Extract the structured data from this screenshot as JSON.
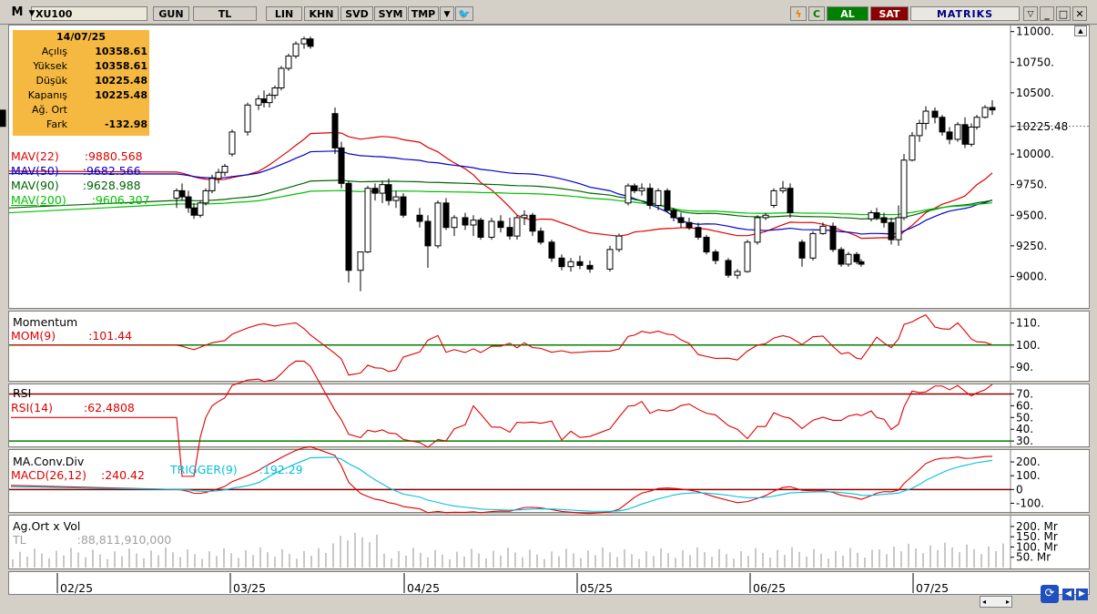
{
  "toolbar": {
    "logo": "M",
    "symbol": "XU100",
    "buttons": [
      "GUN",
      "TL",
      "LIN",
      "KHN",
      "SVD",
      "SYM",
      "TMP"
    ],
    "al": "AL",
    "sat": "SAT",
    "brand": "MATRIKS"
  },
  "info": {
    "date": "14/07/25",
    "rows": [
      {
        "k": "Açılış",
        "v": "10358.61"
      },
      {
        "k": "Yüksek",
        "v": "10358.61"
      },
      {
        "k": "Düşük",
        "v": "10225.48"
      },
      {
        "k": "Kapanış",
        "v": "10225.48"
      },
      {
        "k": "Ağ. Ort",
        "v": ""
      },
      {
        "k": "Fark",
        "v": "-132.98"
      }
    ]
  },
  "legend": {
    "mav22": "MAV(22)",
    "mav22_val": ":9880.568",
    "mav50": "MAV(50)",
    "mav50_val": ":9682.566",
    "mav90": "MAV(90)",
    "mav90_val": ":9628.988",
    "mav200": "MAV(200)",
    "mav200_val": ":9606.307",
    "mom_title": "Momentum",
    "mom": "MOM(9)",
    "mom_val": ":101.44",
    "rsi_title": "RSI",
    "rsi": "RSI(14)",
    "rsi_val": ":62.4808",
    "macd_title": "MA.Conv.Div",
    "macd": "MACD(26,12)",
    "macd_val": ":240.42",
    "trigger": "TRIGGER(9)",
    "trigger_val": ":192.29",
    "vol_title": "Ag.Ort x Vol",
    "vol": "TL",
    "vol_val": ":88,811,910,000"
  },
  "colors": {
    "mav22": "#e00000",
    "mav50": "#0000cc",
    "mav90": "#006400",
    "mav200": "#00c000",
    "mom": "#e00000",
    "rsi": "#e00000",
    "macd": "#e00000",
    "trigger": "#00c0e0",
    "ref_green": "#008000",
    "ref_red": "#8b0000"
  },
  "chart_data": [
    {
      "type": "candlestick",
      "title": "XU100",
      "x_ticks": [
        "02/25",
        "03/25",
        "04/25",
        "05/25",
        "06/25",
        "07/25"
      ],
      "y_ticks": [
        11000,
        10750,
        10500,
        10225.48,
        10000,
        9750,
        9500,
        9250,
        9000
      ],
      "y_tick_labels": [
        "11000.",
        "10750.",
        "10500.",
        "10225.48",
        "10000.",
        "9750.",
        "9500.",
        "9250.",
        "9000."
      ],
      "last_close": 10225.48,
      "ylim": [
        8780,
        11020
      ],
      "candles": [
        [
          9640,
          9720,
          9560,
          9700
        ],
        [
          9700,
          9760,
          9620,
          9650
        ],
        [
          9650,
          9700,
          9520,
          9560
        ],
        [
          9560,
          9600,
          9470,
          9500
        ],
        [
          9500,
          9620,
          9480,
          9600
        ],
        [
          9600,
          9720,
          9580,
          9700
        ],
        [
          9700,
          9830,
          9680,
          9800
        ],
        [
          9800,
          9880,
          9760,
          9850
        ],
        [
          9850,
          9920,
          9820,
          9900
        ],
        [
          10000,
          10200,
          9980,
          10180
        ],
        [
          10180,
          10420,
          10150,
          10400
        ],
        [
          10400,
          10480,
          10360,
          10450
        ],
        [
          10450,
          10520,
          10380,
          10420
        ],
        [
          10420,
          10500,
          10380,
          10480
        ],
        [
          10480,
          10560,
          10450,
          10540
        ],
        [
          10540,
          10720,
          10520,
          10700
        ],
        [
          10700,
          10820,
          10680,
          10800
        ],
        [
          10800,
          10920,
          10780,
          10900
        ],
        [
          10900,
          10960,
          10860,
          10940
        ],
        [
          10940,
          10960,
          10860,
          10880
        ],
        [
          10330,
          10380,
          10000,
          10050
        ],
        [
          10050,
          10100,
          9720,
          9760
        ],
        [
          9760,
          9780,
          8950,
          9050
        ],
        [
          9050,
          9100,
          8880,
          9200
        ],
        [
          9200,
          9740,
          9190,
          9720
        ],
        [
          9720,
          9760,
          9620,
          9680
        ],
        [
          9680,
          9780,
          9600,
          9750
        ],
        [
          9750,
          9800,
          9580,
          9620
        ],
        [
          9620,
          9700,
          9560,
          9650
        ],
        [
          9650,
          9680,
          9480,
          9500
        ],
        [
          9500,
          9560,
          9400,
          9450
        ],
        [
          9450,
          9500,
          9070,
          9250
        ],
        [
          9250,
          9620,
          9230,
          9600
        ],
        [
          9600,
          9640,
          9380,
          9400
        ],
        [
          9400,
          9500,
          9330,
          9480
        ],
        [
          9480,
          9520,
          9380,
          9420
        ],
        [
          9420,
          9500,
          9330,
          9460
        ],
        [
          9460,
          9480,
          9300,
          9320
        ],
        [
          9320,
          9480,
          9300,
          9450
        ],
        [
          9450,
          9500,
          9360,
          9400
        ],
        [
          9400,
          9480,
          9300,
          9330
        ],
        [
          9330,
          9500,
          9300,
          9480
        ],
        [
          9480,
          9540,
          9420,
          9500
        ],
        [
          9500,
          9520,
          9330,
          9370
        ],
        [
          9370,
          9400,
          9260,
          9280
        ],
        [
          9280,
          9300,
          9120,
          9150
        ],
        [
          9150,
          9180,
          9050,
          9080
        ],
        [
          9080,
          9150,
          9040,
          9120
        ],
        [
          9120,
          9170,
          9060,
          9090
        ],
        [
          9090,
          9130,
          9030,
          9060
        ],
        [
          9060,
          9250,
          9040,
          9220
        ],
        [
          9220,
          9350,
          9200,
          9330
        ],
        [
          9600,
          9760,
          9580,
          9740
        ],
        [
          9740,
          9760,
          9680,
          9700
        ],
        [
          9700,
          9760,
          9660,
          9720
        ],
        [
          9720,
          9760,
          9550,
          9580
        ],
        [
          9580,
          9720,
          9540,
          9700
        ],
        [
          9700,
          9720,
          9520,
          9540
        ],
        [
          9540,
          9560,
          9450,
          9480
        ],
        [
          9480,
          9520,
          9400,
          9440
        ],
        [
          9440,
          9480,
          9380,
          9400
        ],
        [
          9400,
          9440,
          9300,
          9320
        ],
        [
          9320,
          9340,
          9180,
          9200
        ],
        [
          9200,
          9220,
          9100,
          9130
        ],
        [
          9130,
          9150,
          8990,
          9010
        ],
        [
          9010,
          9060,
          8980,
          9040
        ],
        [
          9040,
          9300,
          9030,
          9280
        ],
        [
          9280,
          9500,
          9260,
          9480
        ],
        [
          9480,
          9520,
          9460,
          9500
        ],
        [
          9580,
          9720,
          9560,
          9700
        ],
        [
          9700,
          9780,
          9680,
          9720
        ],
        [
          9720,
          9760,
          9480,
          9520
        ],
        [
          9280,
          9300,
          9080,
          9150
        ],
        [
          9150,
          9370,
          9130,
          9350
        ],
        [
          9350,
          9440,
          9340,
          9410
        ],
        [
          9410,
          9440,
          9200,
          9220
        ],
        [
          9220,
          9240,
          9080,
          9100
        ],
        [
          9100,
          9200,
          9080,
          9180
        ],
        [
          9180,
          9200,
          9100,
          9120
        ],
        [
          9120,
          9140,
          9080,
          9100
        ],
        [
          9470,
          9540,
          9450,
          9520
        ],
        [
          9520,
          9560,
          9460,
          9480
        ],
        [
          9480,
          9520,
          9400,
          9440
        ],
        [
          9440,
          9480,
          9260,
          9300
        ],
        [
          9300,
          9580,
          9250,
          9480
        ],
        [
          9480,
          10000,
          9460,
          9950
        ],
        [
          9950,
          10180,
          9940,
          10150
        ],
        [
          10150,
          10280,
          10100,
          10250
        ],
        [
          10250,
          10390,
          10200,
          10350
        ],
        [
          10350,
          10380,
          10250,
          10300
        ],
        [
          10300,
          10320,
          10150,
          10180
        ],
        [
          10180,
          10220,
          10080,
          10120
        ],
        [
          10120,
          10260,
          10100,
          10240
        ],
        [
          10240,
          10300,
          10050,
          10080
        ],
        [
          10080,
          10250,
          10060,
          10220
        ],
        [
          10220,
          10320,
          10200,
          10300
        ],
        [
          10300,
          10400,
          10290,
          10380
        ],
        [
          10380,
          10440,
          10320,
          10360
        ],
        [
          10358.61,
          10358.61,
          10225.48,
          10225.48
        ]
      ],
      "candle_x": [
        194,
        200,
        207,
        213,
        220,
        226,
        233,
        240,
        247,
        255,
        272,
        284,
        290,
        296,
        302,
        309,
        317,
        325,
        334,
        341,
        368,
        375,
        383,
        396,
        404,
        412,
        420,
        427,
        435,
        443,
        461,
        470,
        481,
        490,
        499,
        511,
        520,
        528,
        540,
        550,
        560,
        568,
        576,
        585,
        594,
        606,
        617,
        627,
        637,
        648,
        670,
        680,
        690,
        697,
        705,
        714,
        723,
        733,
        740,
        748,
        757,
        767,
        776,
        786,
        800,
        810,
        821,
        832,
        841,
        850,
        860,
        868,
        881,
        893,
        904,
        915,
        924,
        932,
        941,
        946,
        957,
        963,
        971,
        979,
        987,
        993,
        1002,
        1010,
        1017,
        1027,
        1035,
        1043,
        1052,
        1060,
        1067,
        1073,
        1082,
        1090
      ],
      "series": [
        {
          "name": "MAV(22)",
          "last": 9880.568
        },
        {
          "name": "MAV(50)",
          "last": 9682.566
        },
        {
          "name": "MAV(90)",
          "last": 9628.988
        },
        {
          "name": "MAV(200)",
          "last": 9606.307
        }
      ]
    },
    {
      "type": "line",
      "title": "Momentum",
      "series": [
        {
          "name": "MOM(9)",
          "last": 101.44
        }
      ],
      "y_ticks": [
        110,
        100,
        90
      ],
      "y_tick_labels": [
        "110.",
        "100.",
        "90."
      ],
      "ylim": [
        85,
        114
      ],
      "reference": 100
    },
    {
      "type": "line",
      "title": "RSI",
      "series": [
        {
          "name": "RSI(14)",
          "last": 62.4808
        }
      ],
      "y_ticks": [
        70,
        60,
        50,
        40,
        30
      ],
      "y_tick_labels": [
        "70.",
        "60.",
        "50.",
        "40.",
        "30."
      ],
      "ylim": [
        27,
        75
      ],
      "reference": [
        70,
        30
      ]
    },
    {
      "type": "line",
      "title": "MA.Conv.Div",
      "series": [
        {
          "name": "MACD(26,12)",
          "last": 240.42
        },
        {
          "name": "TRIGGER(9)",
          "last": 192.29
        }
      ],
      "y_ticks": [
        200,
        100,
        0,
        -100
      ],
      "y_tick_labels": [
        "200.",
        "100.",
        "0",
        "-100."
      ],
      "ylim": [
        -150,
        260
      ],
      "reference": 0
    },
    {
      "type": "bar",
      "title": "Ag.Ort x Vol",
      "series": [
        {
          "name": "TL",
          "last": 88811910000
        }
      ],
      "y_ticks": [
        200,
        150,
        100,
        50
      ],
      "y_tick_labels": [
        "200. Mr",
        "150. Mr",
        "100. Mr",
        "50. Mr"
      ],
      "ylim": [
        0,
        235
      ]
    }
  ]
}
